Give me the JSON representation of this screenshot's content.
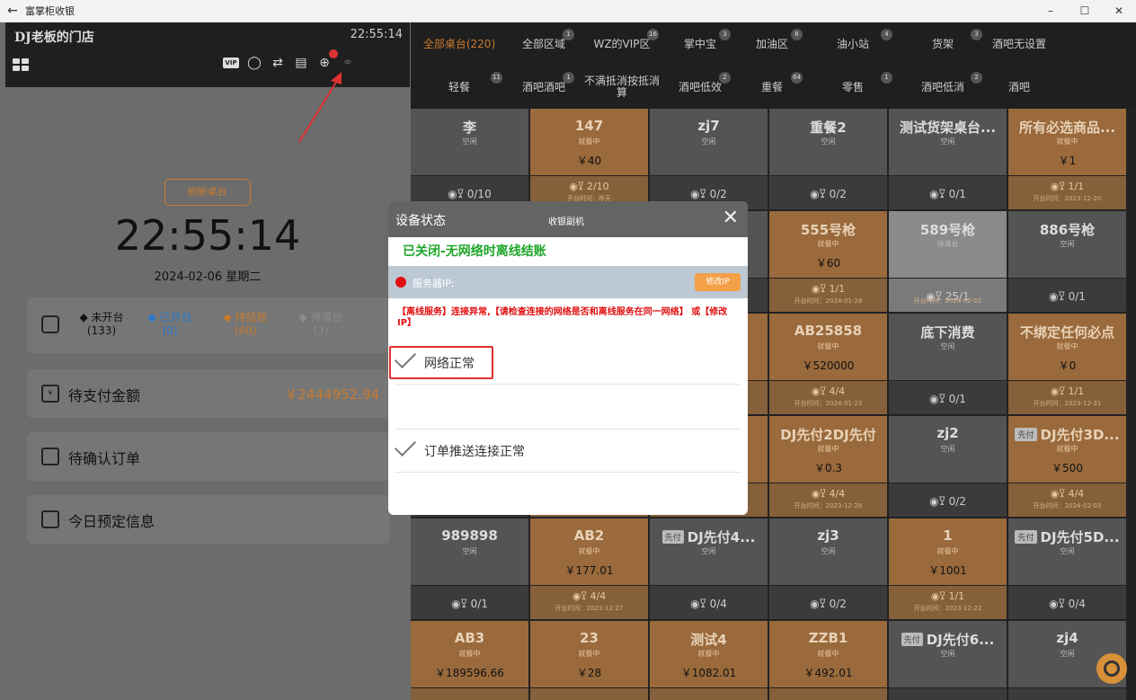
{
  "window": {
    "title": "富掌柜收银",
    "controls": [
      "–",
      "☐",
      "✕"
    ]
  },
  "store": {
    "name": "DJ老板的门店",
    "time": "22:55:14"
  },
  "toolbar": {
    "vip": "VIP"
  },
  "left": {
    "refresh": "刷新桌台",
    "big_time": "22:55:14",
    "date": "2024-02-06 星期二",
    "status": [
      {
        "label": "◆ 未开台",
        "count": "(133)",
        "color": "#111111"
      },
      {
        "label": "◆ 已开台",
        "count": "(0)",
        "color": "#2a78c8"
      },
      {
        "label": "◆ 待结账",
        "count": "(60)",
        "color": "#c87a30"
      },
      {
        "label": "◆ 待清台",
        "count": "(3)",
        "color": "#8c8c8c"
      }
    ],
    "cards": [
      {
        "label": "待支付金额",
        "value": "￥2444952.94",
        "icon": "¥"
      },
      {
        "label": "待确认订单",
        "value": "",
        "icon": ""
      },
      {
        "label": "今日预定信息",
        "value": "",
        "icon": ""
      }
    ]
  },
  "tabs_row1": [
    {
      "label": "全部桌台(220)",
      "count": "",
      "active": true
    },
    {
      "label": "全部区域",
      "count": "1"
    },
    {
      "label": "WZ的VIP区",
      "count": "16"
    },
    {
      "label": "掌中宝",
      "count": "3"
    },
    {
      "label": "加油区",
      "count": "8"
    },
    {
      "label": "油小站",
      "count": "4"
    },
    {
      "label": "货架",
      "count": "3"
    },
    {
      "label": "酒吧无设置",
      "count": ""
    }
  ],
  "tabs_row2": [
    {
      "label": "轻餐",
      "count": "11"
    },
    {
      "label": "酒吧酒吧",
      "count": "1"
    },
    {
      "label": "不满抵消按抵消算",
      "count": ""
    },
    {
      "label": "酒吧低效",
      "count": "2"
    },
    {
      "label": "重餐",
      "count": "64"
    },
    {
      "label": "零售",
      "count": "1"
    },
    {
      "label": "酒吧低消",
      "count": "2"
    },
    {
      "label": "酒吧",
      "count": ""
    }
  ],
  "tables": [
    {
      "name": "李",
      "status": "空闲",
      "amount": "",
      "seats": "◉𐃯 0/10",
      "time": "",
      "state": "idle"
    },
    {
      "name": "147",
      "status": "就餐中",
      "amount": "￥40",
      "seats": "◉𐃯 2/10",
      "time": "开台时间：昨天",
      "state": "busy"
    },
    {
      "name": "zj7",
      "status": "空闲",
      "amount": "",
      "seats": "◉𐃯 0/2",
      "time": "",
      "state": "idle"
    },
    {
      "name": "重餐2",
      "status": "空闲",
      "amount": "",
      "seats": "◉𐃯 0/2",
      "time": "",
      "state": "idle"
    },
    {
      "name": "测试货架桌台...",
      "status": "空闲",
      "amount": "",
      "seats": "◉𐃯 0/1",
      "time": "",
      "state": "idle"
    },
    {
      "name": "所有必选商品...",
      "status": "就餐中",
      "amount": "￥1",
      "seats": "◉𐃯 1/1",
      "time": "开台时间：2023-12-20",
      "state": "busy"
    },
    {
      "name": "",
      "status": "",
      "amount": "",
      "seats": "",
      "time": "",
      "state": "idle"
    },
    {
      "name": "",
      "status": "",
      "amount": "",
      "seats": "",
      "time": "",
      "state": "busy"
    },
    {
      "name": "",
      "status": "",
      "amount": "",
      "seats": "",
      "time": "",
      "state": "idle"
    },
    {
      "name": "555号枪",
      "status": "就餐中",
      "amount": "￥60",
      "seats": "◉𐃯 1/1",
      "time": "开台时间：2024-01-28",
      "state": "busy"
    },
    {
      "name": "589号枪",
      "status": "待清台",
      "amount": "",
      "seats": "◉𐃯 25/1",
      "time": "开台时间：2024-02-02",
      "state": "gray"
    },
    {
      "name": "886号枪",
      "status": "空闲",
      "amount": "",
      "seats": "◉𐃯 0/1",
      "time": "",
      "state": "idle"
    },
    {
      "name": "",
      "status": "",
      "amount": "",
      "seats": "",
      "time": "",
      "state": "idle"
    },
    {
      "name": "",
      "status": "",
      "amount": "",
      "seats": "",
      "time": "",
      "state": "busy"
    },
    {
      "name": "",
      "status": "",
      "amount": "",
      "seats": "",
      "time": "",
      "state": "busy"
    },
    {
      "name": "AB25858",
      "status": "就餐中",
      "amount": "￥520000",
      "seats": "◉𐃯 4/4",
      "time": "开台时间：2024-01-23",
      "state": "busy"
    },
    {
      "name": "底下消费",
      "status": "空闲",
      "amount": "",
      "seats": "◉𐃯 0/1",
      "time": "",
      "state": "idle"
    },
    {
      "name": "不绑定任何必点",
      "status": "就餐中",
      "amount": "￥0",
      "seats": "◉𐃯 1/1",
      "time": "开台时间：2023-12-31",
      "state": "busy"
    },
    {
      "name": "",
      "status": "",
      "amount": "",
      "seats": "",
      "time": "",
      "state": "idle"
    },
    {
      "name": "",
      "status": "",
      "amount": "",
      "seats": "",
      "time": "",
      "state": "busy"
    },
    {
      "name": "",
      "status": "",
      "amount": "",
      "seats": "",
      "time": "",
      "state": "busy"
    },
    {
      "name": "DJ先付2DJ先付",
      "status": "就餐中",
      "amount": "￥0.3",
      "seats": "◉𐃯 4/4",
      "time": "开台时间：2023-12-28",
      "state": "busy"
    },
    {
      "name": "zj2",
      "status": "空闲",
      "amount": "",
      "seats": "◉𐃯 0/2",
      "time": "",
      "state": "idle"
    },
    {
      "name": "DJ先付3D...",
      "prepay": "先付",
      "status": "就餐中",
      "amount": "￥500",
      "seats": "◉𐃯 4/4",
      "time": "开台时间：2024-02-03",
      "state": "busy"
    },
    {
      "name": "989898",
      "status": "空闲",
      "amount": "",
      "seats": "◉𐃯 0/1",
      "time": "",
      "state": "idle"
    },
    {
      "name": "AB2",
      "status": "就餐中",
      "amount": "￥177.01",
      "seats": "◉𐃯 4/4",
      "time": "开台时间：2023-12-27",
      "state": "busy"
    },
    {
      "name": "DJ先付4...",
      "prepay": "先付",
      "status": "空闲",
      "amount": "",
      "seats": "◉𐃯 0/4",
      "time": "",
      "state": "idle"
    },
    {
      "name": "zj3",
      "status": "空闲",
      "amount": "",
      "seats": "◉𐃯 0/2",
      "time": "",
      "state": "idle"
    },
    {
      "name": "1",
      "status": "就餐中",
      "amount": "￥1001",
      "seats": "◉𐃯 1/1",
      "time": "开台时间：2023-12-22",
      "state": "busy"
    },
    {
      "name": "DJ先付5D...",
      "prepay": "先付",
      "status": "空闲",
      "amount": "",
      "seats": "◉𐃯 0/4",
      "time": "",
      "state": "idle"
    },
    {
      "name": "AB3",
      "status": "就餐中",
      "amount": "￥189596.66",
      "seats": "",
      "time": "",
      "state": "busy"
    },
    {
      "name": "23",
      "status": "就餐中",
      "amount": "￥28",
      "seats": "",
      "time": "",
      "state": "busy"
    },
    {
      "name": "测试4",
      "status": "就餐中",
      "amount": "￥1082.01",
      "seats": "",
      "time": "",
      "state": "busy"
    },
    {
      "name": "ZZB1",
      "status": "就餐中",
      "amount": "￥492.01",
      "seats": "",
      "time": "",
      "state": "busy"
    },
    {
      "name": "DJ先付6...",
      "prepay": "先付",
      "status": "空闲",
      "amount": "",
      "seats": "",
      "time": "",
      "state": "idle"
    },
    {
      "name": "zj4",
      "status": "空闲",
      "amount": "",
      "seats": "",
      "time": "",
      "state": "idle"
    }
  ],
  "dialog": {
    "title": "设备状态",
    "subtitle": "收银副机",
    "offline_text": "已关闭-无网络时离线结账",
    "server_label": "服务器IP:",
    "edit_ip": "修改IP",
    "warning": "【离线服务】连接异常,【请检查连接的网络是否和离线服务在同一网络】 或【修改IP】",
    "rows": [
      "网络正常",
      "",
      "订单推送连接正常",
      ""
    ]
  }
}
